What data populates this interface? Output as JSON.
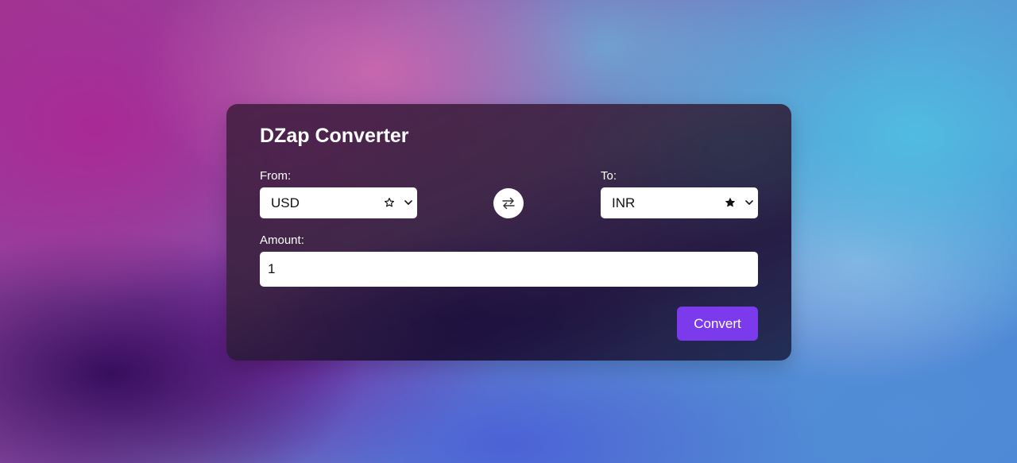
{
  "converter": {
    "title": "DZap Converter",
    "from": {
      "label": "From:",
      "currency": "USD",
      "favorite": false,
      "favorite_icon": "star-outline-icon"
    },
    "to": {
      "label": "To:",
      "currency": "INR",
      "favorite": true,
      "favorite_icon": "star-filled-icon"
    },
    "swap_icon": "swap-arrows-icon",
    "amount": {
      "label": "Amount:",
      "value": "1"
    },
    "convert_label": "Convert"
  },
  "colors": {
    "accent": "#7c3aed",
    "text_on_dark": "#ffffff",
    "field_background": "#ffffff"
  }
}
